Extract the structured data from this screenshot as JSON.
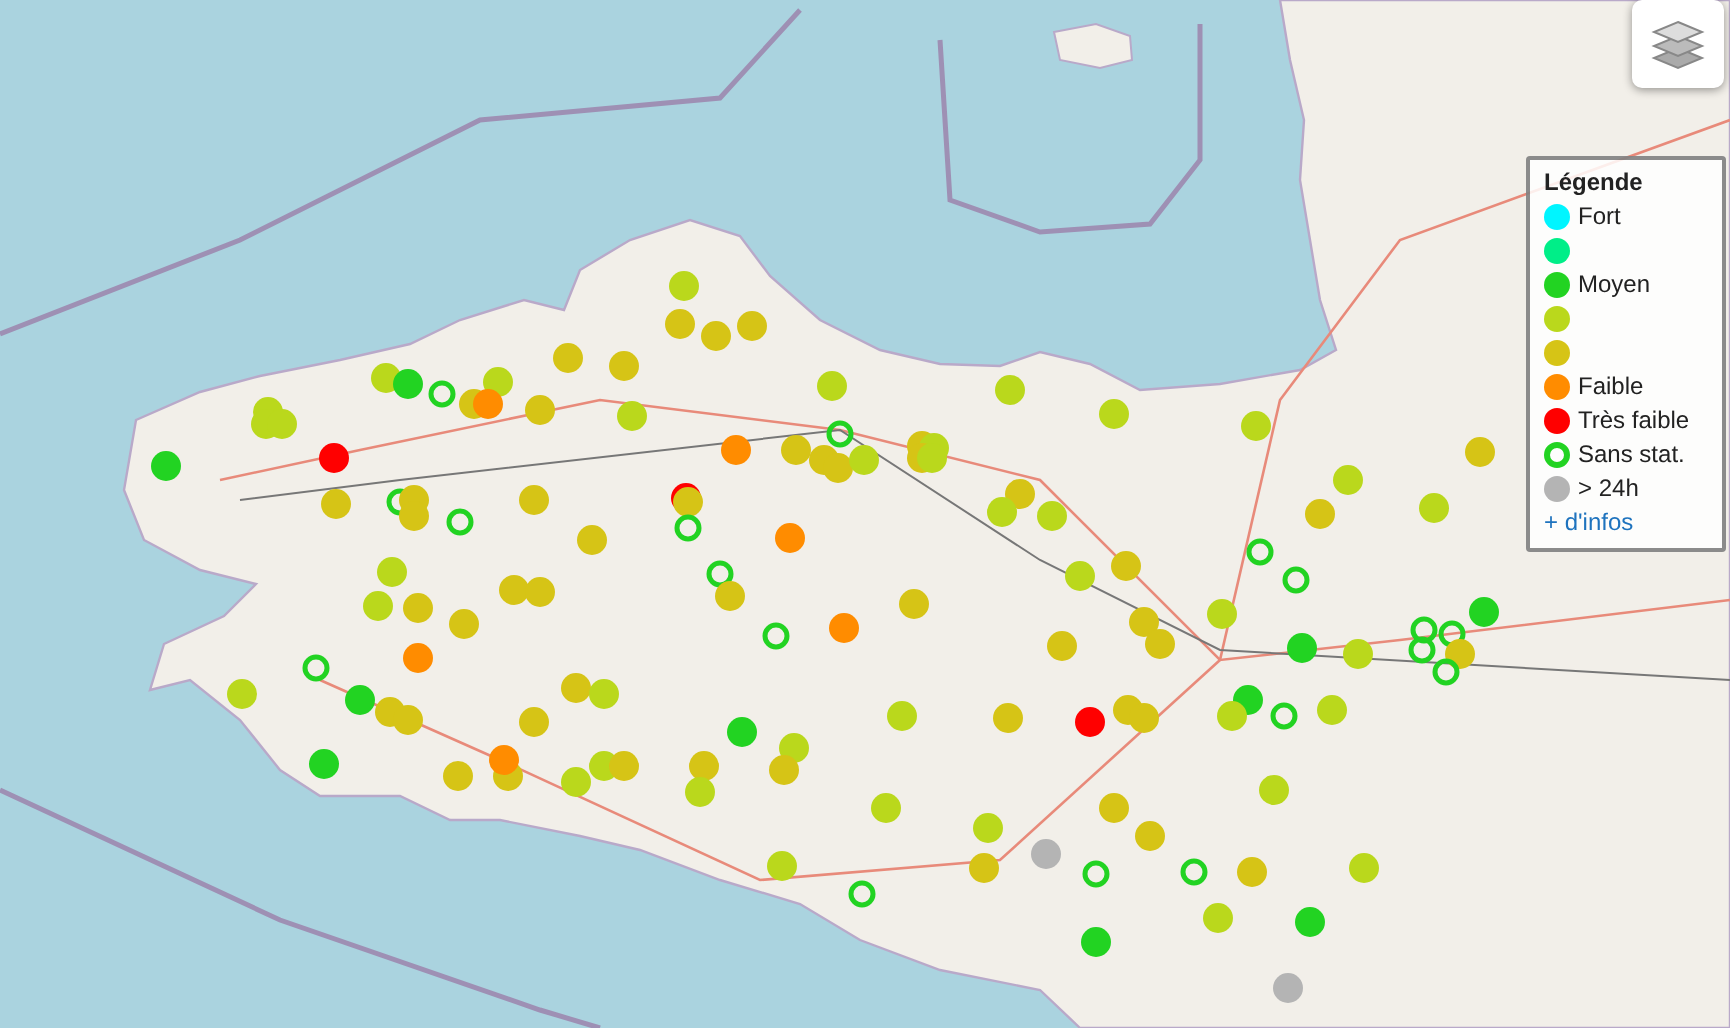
{
  "legend": {
    "title": "Légende",
    "items": [
      {
        "label": "Fort",
        "kind": "dot",
        "color": "#00f5ff"
      },
      {
        "kind": "dot",
        "color": "#00ee88"
      },
      {
        "label": "Moyen",
        "kind": "dot",
        "color": "#22d322"
      },
      {
        "kind": "dot",
        "color": "#bad81c"
      },
      {
        "kind": "dot",
        "color": "#d6c416"
      },
      {
        "label": "Faible",
        "kind": "dot",
        "color": "#ff8c00"
      },
      {
        "label": "Très faible",
        "kind": "dot",
        "color": "#ff0000"
      },
      {
        "label": "Sans stat.",
        "kind": "ring",
        "color": "#22d322"
      },
      {
        "label": "> 24h",
        "kind": "dot",
        "color": "#b4b4b4"
      }
    ],
    "link": "+ d'infos"
  }
}
